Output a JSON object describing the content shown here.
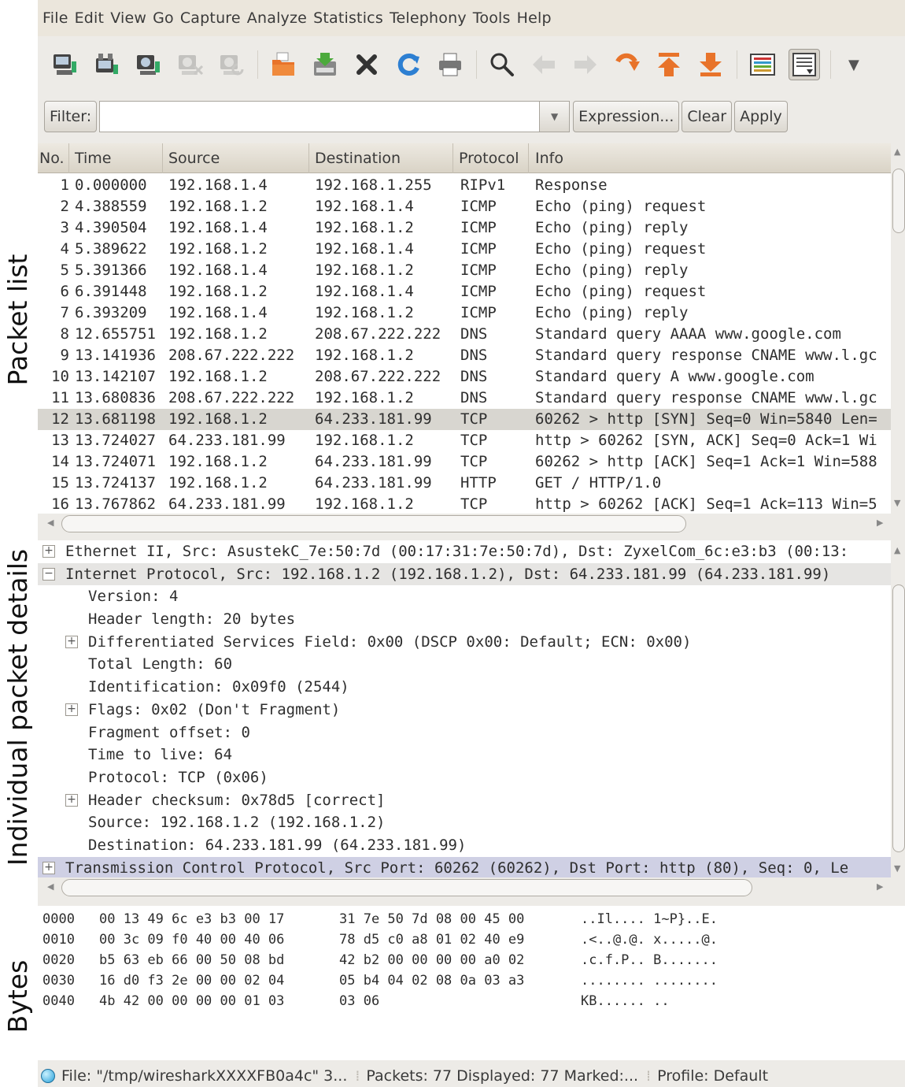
{
  "annotations": {
    "packet_list": "Packet list",
    "details": "Individual packet details",
    "bytes": "Bytes"
  },
  "menu": [
    "File",
    "Edit",
    "View",
    "Go",
    "Capture",
    "Analyze",
    "Statistics",
    "Telephony",
    "Tools",
    "Help"
  ],
  "filter": {
    "label": "Filter:",
    "value": "",
    "expression": "Expression...",
    "clear": "Clear",
    "apply": "Apply"
  },
  "packet_list": {
    "columns": [
      "No.",
      "Time",
      "Source",
      "Destination",
      "Protocol",
      "Info"
    ],
    "rows": [
      {
        "no": "1",
        "time": "0.000000",
        "src": "192.168.1.4",
        "dst": "192.168.1.255",
        "proto": "RIPv1",
        "info": "Response"
      },
      {
        "no": "2",
        "time": "4.388559",
        "src": "192.168.1.2",
        "dst": "192.168.1.4",
        "proto": "ICMP",
        "info": "Echo (ping) request"
      },
      {
        "no": "3",
        "time": "4.390504",
        "src": "192.168.1.4",
        "dst": "192.168.1.2",
        "proto": "ICMP",
        "info": "Echo (ping) reply"
      },
      {
        "no": "4",
        "time": "5.389622",
        "src": "192.168.1.2",
        "dst": "192.168.1.4",
        "proto": "ICMP",
        "info": "Echo (ping) request"
      },
      {
        "no": "5",
        "time": "5.391366",
        "src": "192.168.1.4",
        "dst": "192.168.1.2",
        "proto": "ICMP",
        "info": "Echo (ping) reply"
      },
      {
        "no": "6",
        "time": "6.391448",
        "src": "192.168.1.2",
        "dst": "192.168.1.4",
        "proto": "ICMP",
        "info": "Echo (ping) request"
      },
      {
        "no": "7",
        "time": "6.393209",
        "src": "192.168.1.4",
        "dst": "192.168.1.2",
        "proto": "ICMP",
        "info": "Echo (ping) reply"
      },
      {
        "no": "8",
        "time": "12.655751",
        "src": "192.168.1.2",
        "dst": "208.67.222.222",
        "proto": "DNS",
        "info": "Standard query AAAA www.google.com"
      },
      {
        "no": "9",
        "time": "13.141936",
        "src": "208.67.222.222",
        "dst": "192.168.1.2",
        "proto": "DNS",
        "info": "Standard query response CNAME www.l.gc"
      },
      {
        "no": "10",
        "time": "13.142107",
        "src": "192.168.1.2",
        "dst": "208.67.222.222",
        "proto": "DNS",
        "info": "Standard query A www.google.com"
      },
      {
        "no": "11",
        "time": "13.680836",
        "src": "208.67.222.222",
        "dst": "192.168.1.2",
        "proto": "DNS",
        "info": "Standard query response CNAME www.l.gc"
      },
      {
        "no": "12",
        "time": "13.681198",
        "src": "192.168.1.2",
        "dst": "64.233.181.99",
        "proto": "TCP",
        "info": "60262 > http [SYN] Seq=0 Win=5840 Len="
      },
      {
        "no": "13",
        "time": "13.724027",
        "src": "64.233.181.99",
        "dst": "192.168.1.2",
        "proto": "TCP",
        "info": "http > 60262 [SYN, ACK] Seq=0 Ack=1 Wi"
      },
      {
        "no": "14",
        "time": "13.724071",
        "src": "192.168.1.2",
        "dst": "64.233.181.99",
        "proto": "TCP",
        "info": "60262 > http [ACK] Seq=1 Ack=1 Win=588"
      },
      {
        "no": "15",
        "time": "13.724137",
        "src": "192.168.1.2",
        "dst": "64.233.181.99",
        "proto": "HTTP",
        "info": "GET / HTTP/1.0"
      },
      {
        "no": "16",
        "time": "13.767862",
        "src": "64.233.181.99",
        "dst": "192.168.1.2",
        "proto": "TCP",
        "info": "http > 60262 [ACK] Seq=1 Ack=113 Win=5"
      }
    ],
    "selected_no": "12"
  },
  "details": {
    "lines": [
      {
        "indent": 0,
        "expander": "+",
        "text": "Ethernet II, Src: AsustekC_7e:50:7d (00:17:31:7e:50:7d), Dst: ZyxelCom_6c:e3:b3 (00:13:",
        "state": ""
      },
      {
        "indent": 0,
        "expander": "−",
        "text": "Internet Protocol, Src: 192.168.1.2 (192.168.1.2), Dst: 64.233.181.99 (64.233.181.99)",
        "state": "hl"
      },
      {
        "indent": 1,
        "expander": "",
        "text": "Version: 4",
        "state": ""
      },
      {
        "indent": 1,
        "expander": "",
        "text": "Header length: 20 bytes",
        "state": ""
      },
      {
        "indent": 1,
        "expander": "+",
        "text": "Differentiated Services Field: 0x00 (DSCP 0x00: Default; ECN: 0x00)",
        "state": ""
      },
      {
        "indent": 1,
        "expander": "",
        "text": "Total Length: 60",
        "state": ""
      },
      {
        "indent": 1,
        "expander": "",
        "text": "Identification: 0x09f0 (2544)",
        "state": ""
      },
      {
        "indent": 1,
        "expander": "+",
        "text": "Flags: 0x02 (Don't Fragment)",
        "state": ""
      },
      {
        "indent": 1,
        "expander": "",
        "text": "Fragment offset: 0",
        "state": ""
      },
      {
        "indent": 1,
        "expander": "",
        "text": "Time to live: 64",
        "state": ""
      },
      {
        "indent": 1,
        "expander": "",
        "text": "Protocol: TCP (0x06)",
        "state": ""
      },
      {
        "indent": 1,
        "expander": "+",
        "text": "Header checksum: 0x78d5 [correct]",
        "state": ""
      },
      {
        "indent": 1,
        "expander": "",
        "text": "Source: 192.168.1.2 (192.168.1.2)",
        "state": ""
      },
      {
        "indent": 1,
        "expander": "",
        "text": "Destination: 64.233.181.99 (64.233.181.99)",
        "state": ""
      },
      {
        "indent": 0,
        "expander": "+",
        "text": "Transmission Control Protocol, Src Port: 60262 (60262), Dst Port: http (80), Seq: 0, Le",
        "state": "sel"
      }
    ]
  },
  "bytes": {
    "rows": [
      {
        "offset": "0000",
        "hex1": "00 13 49 6c e3 b3 00 17",
        "hex2": "31 7e 50 7d 08 00 45 00",
        "ascii": "..Il.... 1~P}..E."
      },
      {
        "offset": "0010",
        "hex1": "00 3c 09 f0 40 00 40 06",
        "hex2": "78 d5 c0 a8 01 02 40 e9",
        "ascii": ".<..@.@. x.....@."
      },
      {
        "offset": "0020",
        "hex1": "b5 63 eb 66 00 50 08 bd",
        "hex2": "42 b2 00 00 00 00 a0 02",
        "ascii": ".c.f.P.. B......."
      },
      {
        "offset": "0030",
        "hex1": "16 d0 f3 2e 00 00 02 04",
        "hex2": "05 b4 04 02 08 0a 03 a3",
        "ascii": "........ ........"
      },
      {
        "offset": "0040",
        "hex1": "4b 42 00 00 00 00 01 03",
        "hex2": "03 06",
        "ascii": "KB...... .."
      }
    ]
  },
  "status": {
    "file": "File: \"/tmp/wiresharkXXXXFB0a4c\" 3...",
    "packets": "Packets: 77 Displayed: 77 Marked:...",
    "profile": "Profile: Default"
  }
}
